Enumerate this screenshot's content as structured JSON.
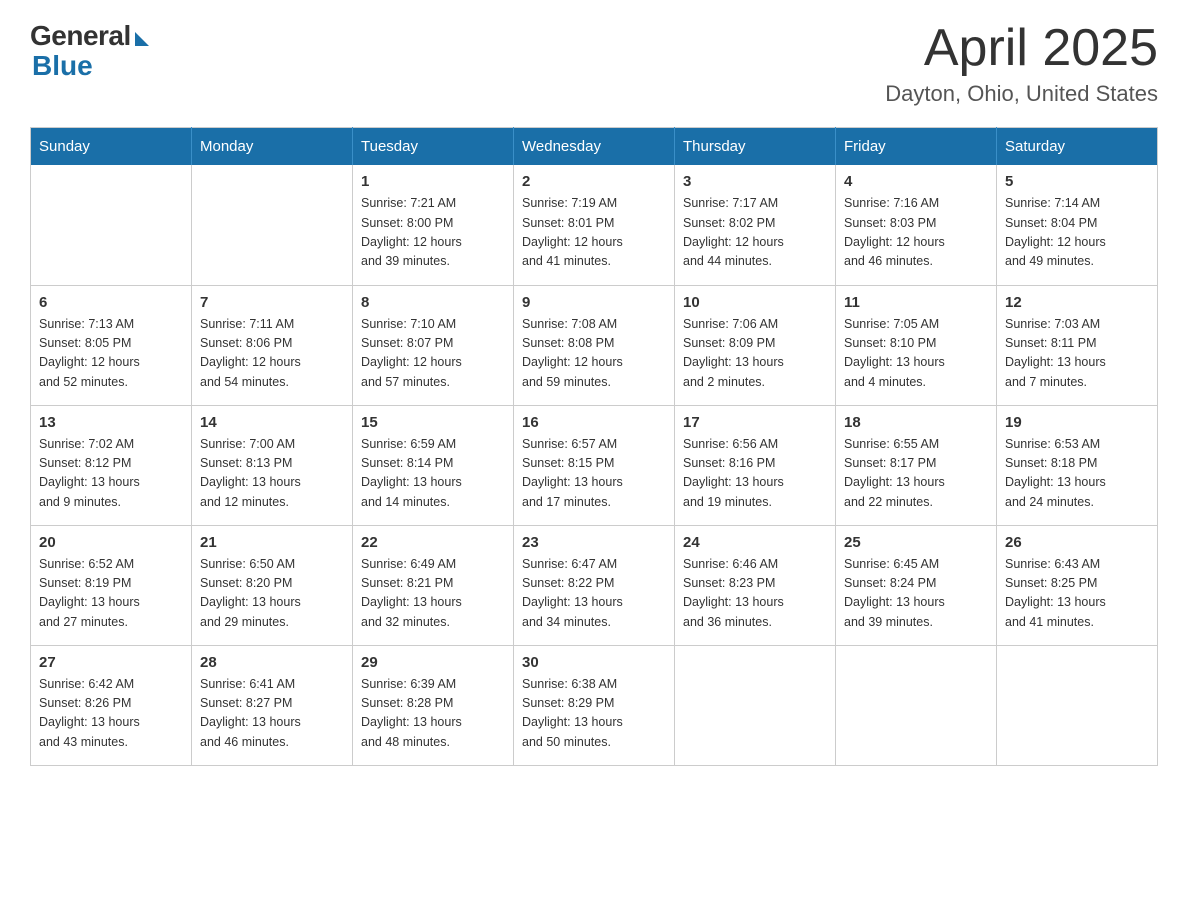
{
  "logo": {
    "general": "General",
    "blue": "Blue"
  },
  "title": "April 2025",
  "location": "Dayton, Ohio, United States",
  "days_of_week": [
    "Sunday",
    "Monday",
    "Tuesday",
    "Wednesday",
    "Thursday",
    "Friday",
    "Saturday"
  ],
  "weeks": [
    [
      {
        "day": "",
        "info": ""
      },
      {
        "day": "",
        "info": ""
      },
      {
        "day": "1",
        "info": "Sunrise: 7:21 AM\nSunset: 8:00 PM\nDaylight: 12 hours\nand 39 minutes."
      },
      {
        "day": "2",
        "info": "Sunrise: 7:19 AM\nSunset: 8:01 PM\nDaylight: 12 hours\nand 41 minutes."
      },
      {
        "day": "3",
        "info": "Sunrise: 7:17 AM\nSunset: 8:02 PM\nDaylight: 12 hours\nand 44 minutes."
      },
      {
        "day": "4",
        "info": "Sunrise: 7:16 AM\nSunset: 8:03 PM\nDaylight: 12 hours\nand 46 minutes."
      },
      {
        "day": "5",
        "info": "Sunrise: 7:14 AM\nSunset: 8:04 PM\nDaylight: 12 hours\nand 49 minutes."
      }
    ],
    [
      {
        "day": "6",
        "info": "Sunrise: 7:13 AM\nSunset: 8:05 PM\nDaylight: 12 hours\nand 52 minutes."
      },
      {
        "day": "7",
        "info": "Sunrise: 7:11 AM\nSunset: 8:06 PM\nDaylight: 12 hours\nand 54 minutes."
      },
      {
        "day": "8",
        "info": "Sunrise: 7:10 AM\nSunset: 8:07 PM\nDaylight: 12 hours\nand 57 minutes."
      },
      {
        "day": "9",
        "info": "Sunrise: 7:08 AM\nSunset: 8:08 PM\nDaylight: 12 hours\nand 59 minutes."
      },
      {
        "day": "10",
        "info": "Sunrise: 7:06 AM\nSunset: 8:09 PM\nDaylight: 13 hours\nand 2 minutes."
      },
      {
        "day": "11",
        "info": "Sunrise: 7:05 AM\nSunset: 8:10 PM\nDaylight: 13 hours\nand 4 minutes."
      },
      {
        "day": "12",
        "info": "Sunrise: 7:03 AM\nSunset: 8:11 PM\nDaylight: 13 hours\nand 7 minutes."
      }
    ],
    [
      {
        "day": "13",
        "info": "Sunrise: 7:02 AM\nSunset: 8:12 PM\nDaylight: 13 hours\nand 9 minutes."
      },
      {
        "day": "14",
        "info": "Sunrise: 7:00 AM\nSunset: 8:13 PM\nDaylight: 13 hours\nand 12 minutes."
      },
      {
        "day": "15",
        "info": "Sunrise: 6:59 AM\nSunset: 8:14 PM\nDaylight: 13 hours\nand 14 minutes."
      },
      {
        "day": "16",
        "info": "Sunrise: 6:57 AM\nSunset: 8:15 PM\nDaylight: 13 hours\nand 17 minutes."
      },
      {
        "day": "17",
        "info": "Sunrise: 6:56 AM\nSunset: 8:16 PM\nDaylight: 13 hours\nand 19 minutes."
      },
      {
        "day": "18",
        "info": "Sunrise: 6:55 AM\nSunset: 8:17 PM\nDaylight: 13 hours\nand 22 minutes."
      },
      {
        "day": "19",
        "info": "Sunrise: 6:53 AM\nSunset: 8:18 PM\nDaylight: 13 hours\nand 24 minutes."
      }
    ],
    [
      {
        "day": "20",
        "info": "Sunrise: 6:52 AM\nSunset: 8:19 PM\nDaylight: 13 hours\nand 27 minutes."
      },
      {
        "day": "21",
        "info": "Sunrise: 6:50 AM\nSunset: 8:20 PM\nDaylight: 13 hours\nand 29 minutes."
      },
      {
        "day": "22",
        "info": "Sunrise: 6:49 AM\nSunset: 8:21 PM\nDaylight: 13 hours\nand 32 minutes."
      },
      {
        "day": "23",
        "info": "Sunrise: 6:47 AM\nSunset: 8:22 PM\nDaylight: 13 hours\nand 34 minutes."
      },
      {
        "day": "24",
        "info": "Sunrise: 6:46 AM\nSunset: 8:23 PM\nDaylight: 13 hours\nand 36 minutes."
      },
      {
        "day": "25",
        "info": "Sunrise: 6:45 AM\nSunset: 8:24 PM\nDaylight: 13 hours\nand 39 minutes."
      },
      {
        "day": "26",
        "info": "Sunrise: 6:43 AM\nSunset: 8:25 PM\nDaylight: 13 hours\nand 41 minutes."
      }
    ],
    [
      {
        "day": "27",
        "info": "Sunrise: 6:42 AM\nSunset: 8:26 PM\nDaylight: 13 hours\nand 43 minutes."
      },
      {
        "day": "28",
        "info": "Sunrise: 6:41 AM\nSunset: 8:27 PM\nDaylight: 13 hours\nand 46 minutes."
      },
      {
        "day": "29",
        "info": "Sunrise: 6:39 AM\nSunset: 8:28 PM\nDaylight: 13 hours\nand 48 minutes."
      },
      {
        "day": "30",
        "info": "Sunrise: 6:38 AM\nSunset: 8:29 PM\nDaylight: 13 hours\nand 50 minutes."
      },
      {
        "day": "",
        "info": ""
      },
      {
        "day": "",
        "info": ""
      },
      {
        "day": "",
        "info": ""
      }
    ]
  ]
}
